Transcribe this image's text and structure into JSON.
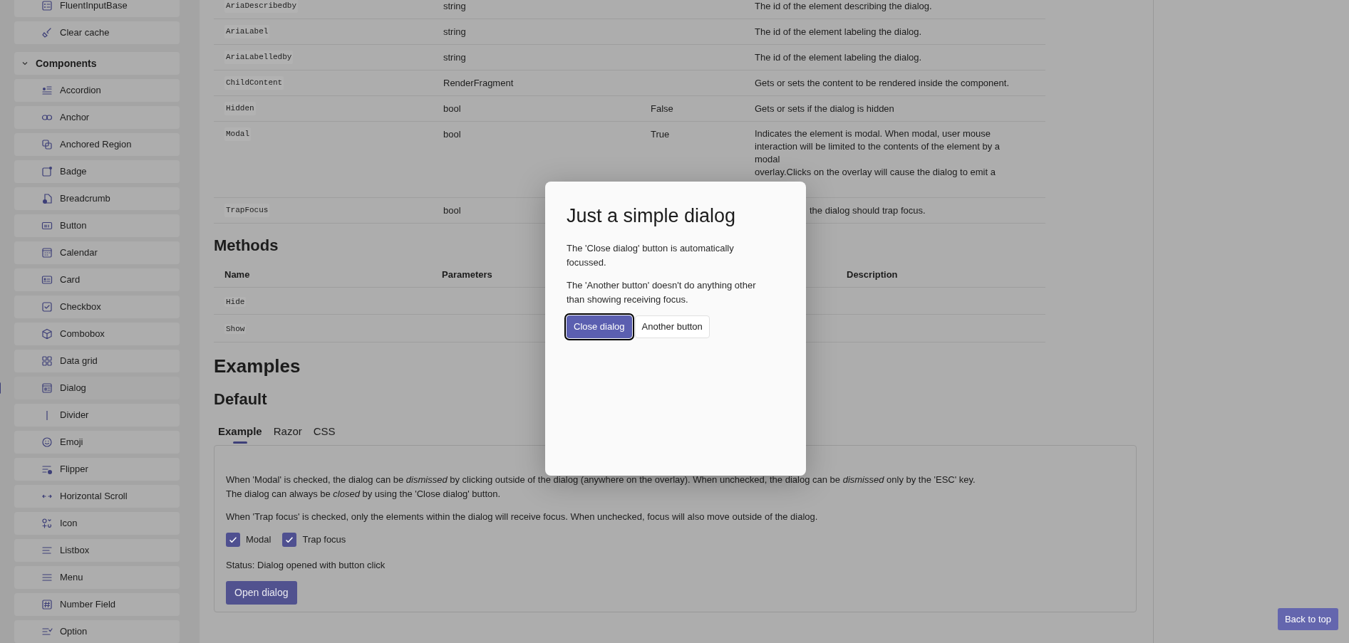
{
  "sidebar": {
    "items": [
      {
        "label": "FluentInputBase"
      },
      {
        "label": "Clear cache"
      }
    ],
    "groups": [
      {
        "label": "Components",
        "expanded": true,
        "children": [
          {
            "label": "Accordion",
            "selected": false
          },
          {
            "label": "Anchor",
            "selected": false
          },
          {
            "label": "Anchored Region",
            "selected": false
          },
          {
            "label": "Badge",
            "selected": false
          },
          {
            "label": "Breadcrumb",
            "selected": false
          },
          {
            "label": "Button",
            "selected": false
          },
          {
            "label": "Calendar",
            "selected": false
          },
          {
            "label": "Card",
            "selected": false
          },
          {
            "label": "Checkbox",
            "selected": false
          },
          {
            "label": "Combobox",
            "selected": false
          },
          {
            "label": "Data grid",
            "selected": false
          },
          {
            "label": "Dialog",
            "selected": true
          },
          {
            "label": "Divider",
            "selected": false
          },
          {
            "label": "Emoji",
            "selected": false
          },
          {
            "label": "Flipper",
            "selected": false
          },
          {
            "label": "Horizontal Scroll",
            "selected": false
          },
          {
            "label": "Icon",
            "selected": false
          },
          {
            "label": "Listbox",
            "selected": false
          },
          {
            "label": "Menu",
            "selected": false
          },
          {
            "label": "Number Field",
            "selected": false
          },
          {
            "label": "Option",
            "selected": false
          }
        ]
      }
    ]
  },
  "properties_table": {
    "rows": [
      {
        "column_1": "AriaDescribedby",
        "column_2": "string",
        "column_4": [
          "The id of the element describing the dialog."
        ]
      },
      {
        "column_1": "AriaLabel",
        "column_2": "string",
        "column_4": [
          "The id of the element labeling the dialog."
        ]
      },
      {
        "column_1": "AriaLabelledby",
        "column_2": "string",
        "column_4": [
          "The id of the element labeling the dialog."
        ]
      },
      {
        "column_1": "ChildContent",
        "column_2": "RenderFragment",
        "column_4": [
          "Gets or sets the content to be rendered inside the component."
        ]
      },
      {
        "column_1": "Hidden",
        "column_2": "bool",
        "column_3": "False",
        "column_4": [
          "Gets or sets if the dialog is hidden"
        ]
      },
      {
        "column_1": "Modal",
        "column_2": "bool",
        "column_3": "True",
        "column_4": [
          "Indicates the element is modal. When modal, user mouse interaction will be limited to the contents of the element by a modal",
          "overlay.Clicks on the overlay will cause the dialog to emit a"
        ]
      },
      {
        "column_1": "TrapFocus",
        "column_2": "bool",
        "column_4": [
          "the dialog should trap focus."
        ]
      }
    ]
  },
  "methods": {
    "title": "Methods",
    "columns": [
      "Name",
      "Parameters",
      "Description"
    ],
    "rows": [
      {
        "name": "Hide"
      },
      {
        "name": "Show"
      }
    ]
  },
  "examples": {
    "title": "Examples",
    "subtitle": "Default",
    "tabs": [
      {
        "label": "Example",
        "selected": true
      },
      {
        "label": "Razor",
        "selected": false
      },
      {
        "label": "CSS",
        "selected": false
      }
    ],
    "paragraphs": [
      {
        "lines": [
          "When 'Modal' is checked, the dialog can be *dismissed* by clicking outside of the dialog (anywhere on the overlay). When unchecked, the dialog can be *dismissed* only by the 'ESC' key.",
          "The dialog can always be *closed* by using the 'Close dialog' button."
        ]
      },
      {
        "lines": [
          "When 'Trap focus' is checked, only the elements within the dialog will receive focus. When unchecked, focus will also move outside of the dialog."
        ]
      }
    ],
    "checkboxes": [
      {
        "label": "Modal",
        "checked": true
      },
      {
        "label": "Trap focus",
        "checked": true
      }
    ],
    "status": "Status: Dialog opened with button click",
    "button": "Open dialog"
  },
  "dialog": {
    "title": "Just a simple dialog",
    "paragraphs": [
      "The 'Close dialog' button is automatically focussed.",
      "The 'Another button' doesn't do anything other than showing receiving focus."
    ],
    "buttons": [
      {
        "label": "Close dialog",
        "kind": "primary",
        "focused": true
      },
      {
        "label": "Another button",
        "kind": "secondary",
        "focused": false
      }
    ]
  },
  "back_to_top": "Back to top"
}
